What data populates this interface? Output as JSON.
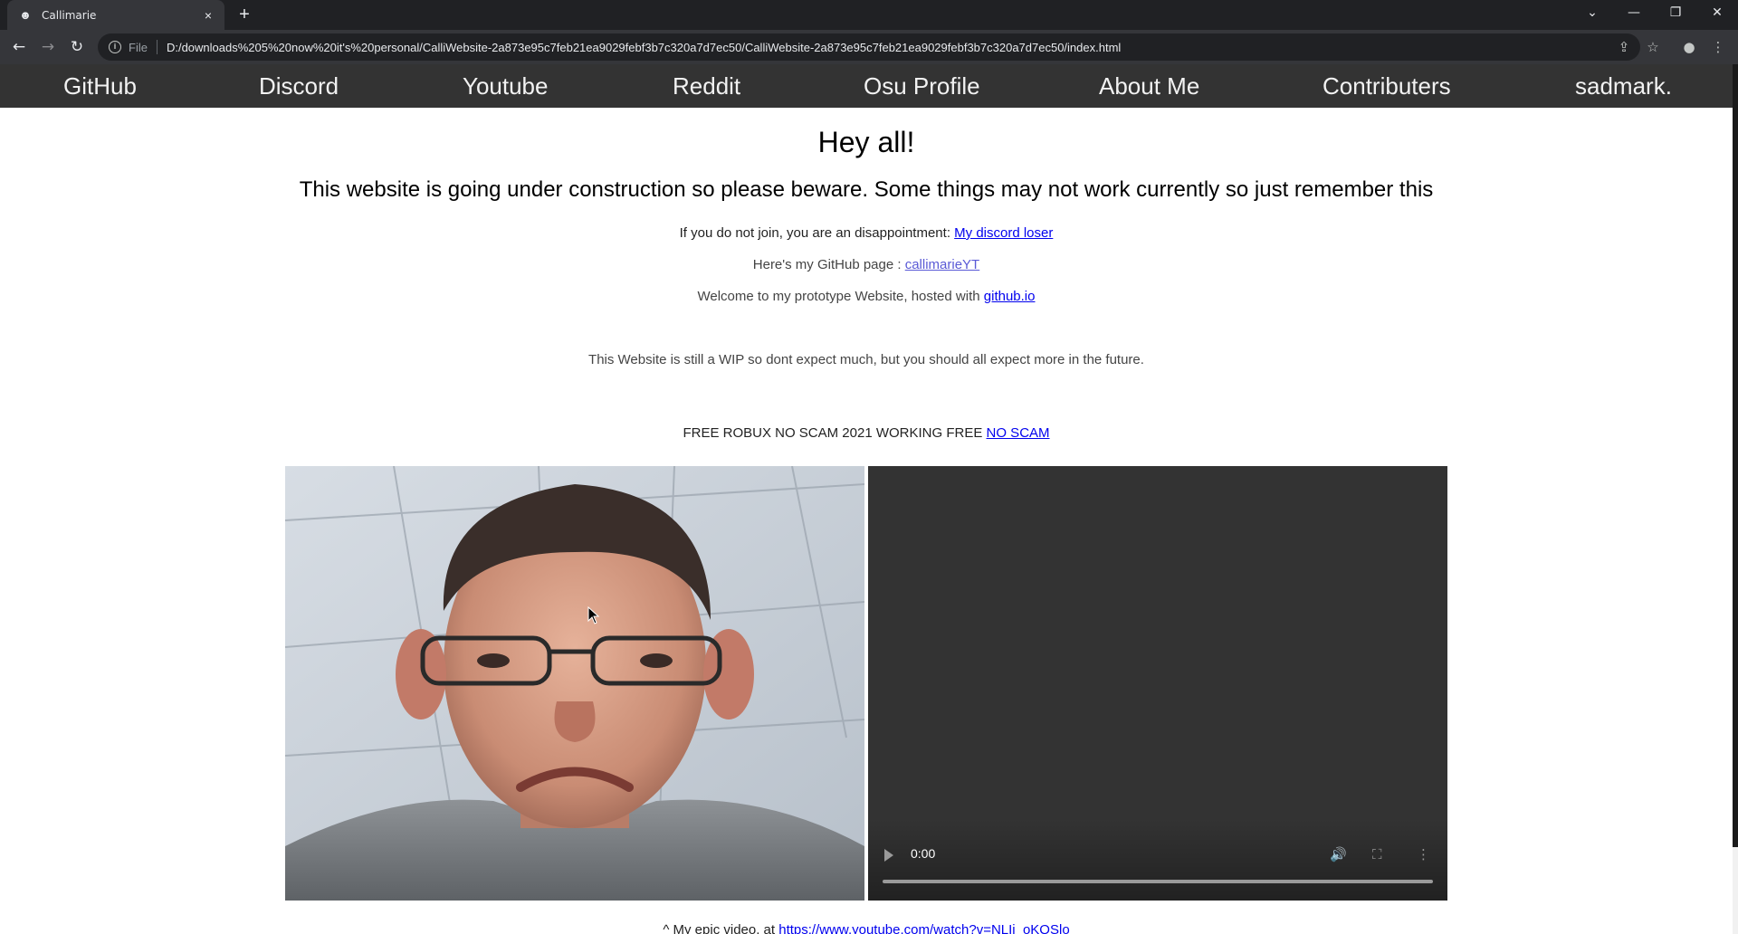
{
  "browser": {
    "tab_title": "Callimarie",
    "tab_close": "×",
    "new_tab": "+",
    "window_controls": {
      "tab_search": "⌄",
      "minimize": "—",
      "restore": "❐",
      "close": "✕"
    },
    "nav": {
      "back": "←",
      "forward": "→",
      "reload": "↻"
    },
    "omnibox": {
      "info": "i",
      "scheme": "File",
      "url": "D:/downloads%205%20now%20it's%20personal/CalliWebsite-2a873e95c7feb21ea9029febf3b7c320a7d7ec50/CalliWebsite-2a873e95c7feb21ea9029febf3b7c320a7d7ec50/index.html"
    },
    "toolbar_icons": {
      "share": "⇪",
      "bookmark": "☆",
      "profile": "●",
      "menu": "⋮"
    }
  },
  "site_nav": {
    "items": [
      "GitHub",
      "Discord",
      "Youtube",
      "Reddit",
      "Osu Profile",
      "About Me",
      "Contributers",
      "sadmark."
    ]
  },
  "content": {
    "heading": "Hey all!",
    "subheading": "This website is going under construction so please beware. Some things may not work currently so just remember this",
    "discord_line": {
      "text": "If you do not join, you are an disappointment: ",
      "link": "My discord loser"
    },
    "github_line": {
      "text": "Here's my GitHub page : ",
      "link": "callimarieYT"
    },
    "welcome_line": {
      "text": "Welcome to my prototype Website, hosted with ",
      "link": "github.io"
    },
    "wip_line": "This Website is still a WIP so dont expect much, but you should all expect more in the future.",
    "robux_line": {
      "text": "FREE ROBUX NO SCAM 2021 WORKING FREE ",
      "link": "NO SCAM"
    },
    "video_caption": {
      "text": "^ My epic video, at ",
      "link": "https://www.youtube.com/watch?v=NLIi_oKQSlo"
    }
  },
  "video": {
    "time": "0:00",
    "icons": {
      "play": "play-icon",
      "volume": "🔊",
      "fullscreen": "⛶",
      "more": "⋮"
    }
  }
}
